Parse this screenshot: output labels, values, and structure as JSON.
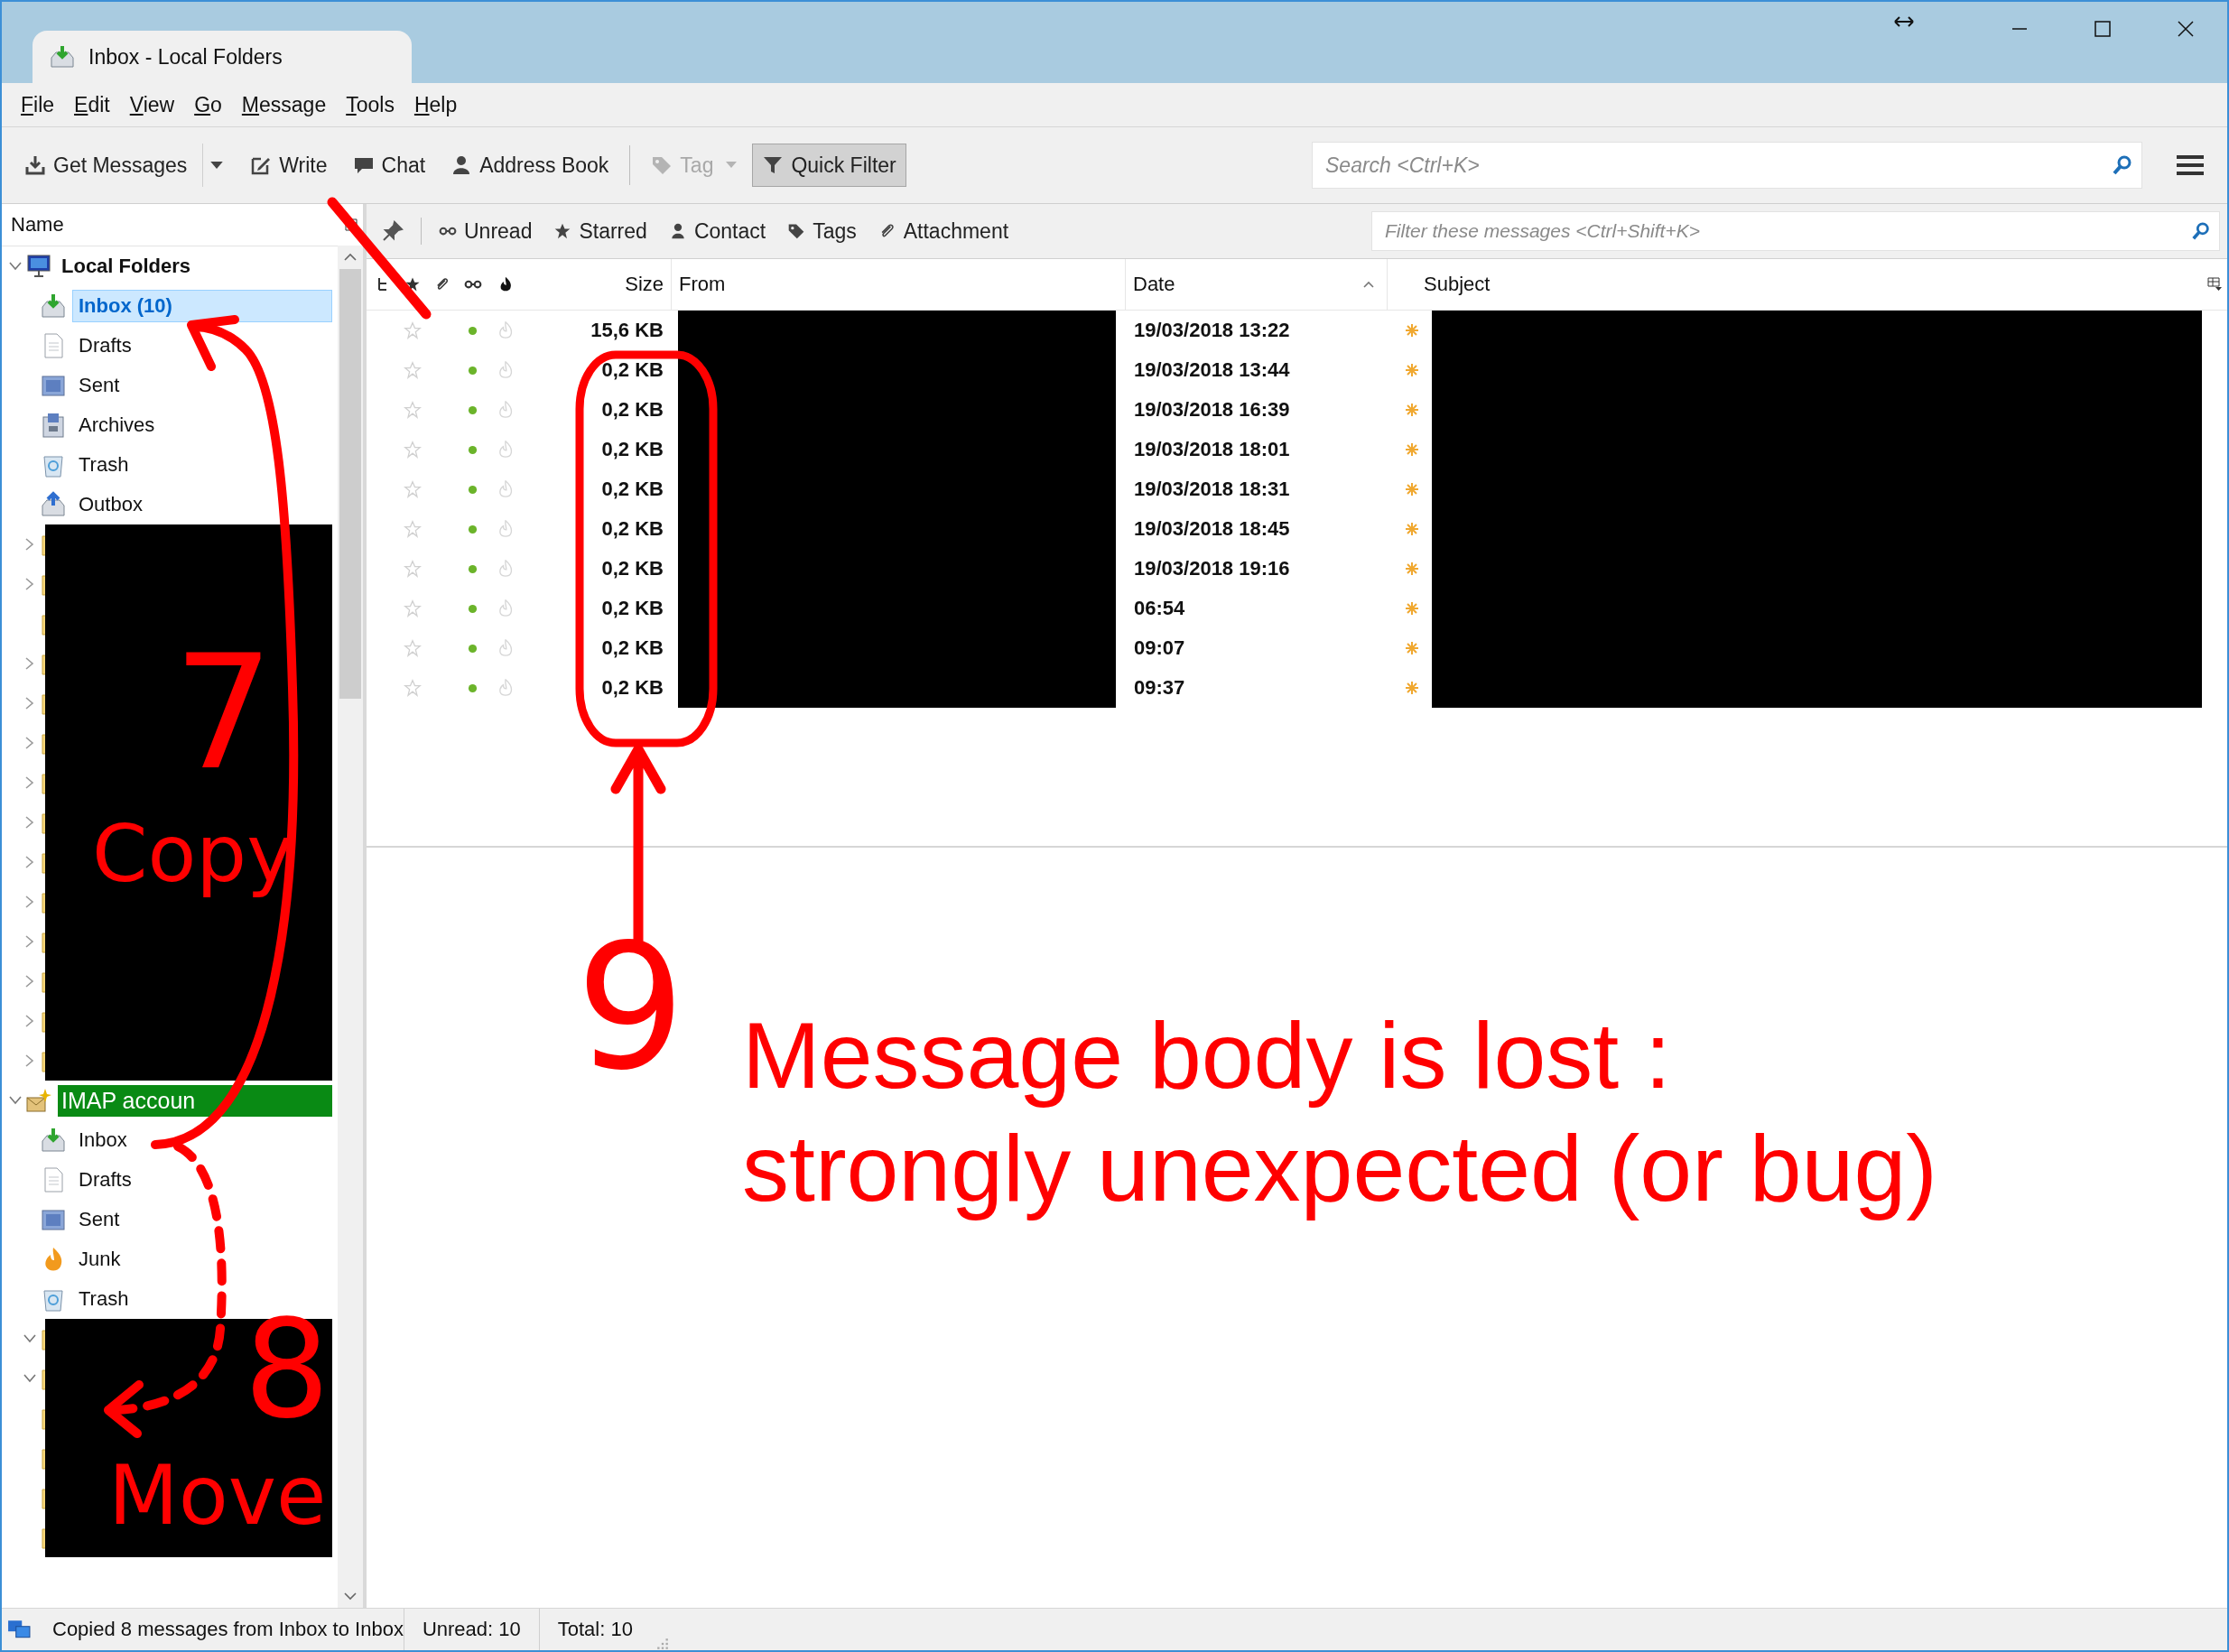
{
  "window": {
    "title": "Inbox - Local Folders"
  },
  "menu": [
    "File",
    "Edit",
    "View",
    "Go",
    "Message",
    "Tools",
    "Help"
  ],
  "toolbar": {
    "buttons": [
      {
        "label": "Get Messages",
        "kind": "split",
        "disabled": false,
        "selected": false
      },
      {
        "label": "Write",
        "kind": "plain",
        "disabled": false,
        "selected": false
      },
      {
        "label": "Chat",
        "kind": "plain",
        "disabled": false,
        "selected": false
      },
      {
        "label": "Address Book",
        "kind": "plain",
        "disabled": false,
        "selected": false
      },
      {
        "label": "Tag",
        "kind": "menu",
        "disabled": true,
        "selected": false
      },
      {
        "label": "Quick Filter",
        "kind": "plain",
        "disabled": false,
        "selected": true
      }
    ],
    "search": {
      "placeholder": "Search <Ctrl+K>"
    }
  },
  "quick_filter": {
    "toggles": [
      {
        "label": "Unread",
        "selected": false
      },
      {
        "label": "Starred",
        "selected": false
      },
      {
        "label": "Contact",
        "selected": false
      },
      {
        "label": "Tags",
        "selected": false
      },
      {
        "label": "Attachment",
        "selected": false
      }
    ],
    "placeholder": "Filter these messages <Ctrl+Shift+K>"
  },
  "folder_pane": {
    "header": "Name",
    "accounts": [
      {
        "name": "Local Folders",
        "kind": "local",
        "expanded": true,
        "selected": false,
        "highlighted": false,
        "children": [
          {
            "name": "Inbox (10)",
            "kind": "inbox",
            "selected": true
          },
          {
            "name": "Drafts",
            "kind": "drafts",
            "selected": false
          },
          {
            "name": "Sent",
            "kind": "sent",
            "selected": false
          },
          {
            "name": "Archives",
            "kind": "archives",
            "selected": false
          },
          {
            "name": "Trash",
            "kind": "trash",
            "selected": false
          },
          {
            "name": "Outbox",
            "kind": "outbox",
            "selected": false
          },
          {
            "kind": "redacted",
            "expanded": false
          },
          {
            "kind": "redacted",
            "expanded": false
          },
          {
            "kind": "redacted"
          },
          {
            "kind": "redacted",
            "expanded": false
          },
          {
            "kind": "redacted",
            "expanded": false
          },
          {
            "kind": "redacted",
            "expanded": false
          },
          {
            "kind": "redacted",
            "expanded": false
          },
          {
            "kind": "redacted",
            "expanded": false
          },
          {
            "kind": "redacted",
            "expanded": false
          },
          {
            "kind": "redacted",
            "expanded": false
          },
          {
            "kind": "redacted",
            "expanded": false
          },
          {
            "kind": "redacted",
            "expanded": false
          },
          {
            "kind": "redacted",
            "expanded": false
          },
          {
            "kind": "redacted",
            "expanded": false
          }
        ]
      },
      {
        "name": "IMAP accoun",
        "kind": "imap",
        "expanded": true,
        "selected": false,
        "highlighted": true,
        "children": [
          {
            "name": "Inbox",
            "kind": "inbox",
            "selected": false
          },
          {
            "name": "Drafts",
            "kind": "drafts",
            "selected": false
          },
          {
            "name": "Sent",
            "kind": "sent",
            "selected": false
          },
          {
            "name": "Junk",
            "kind": "junk",
            "selected": false
          },
          {
            "name": "Trash",
            "kind": "trash",
            "selected": false
          },
          {
            "kind": "redacted",
            "expanded": true
          },
          {
            "kind": "redacted",
            "expanded": true
          },
          {
            "kind": "redacted"
          },
          {
            "kind": "redacted"
          },
          {
            "kind": "redacted"
          },
          {
            "kind": "redacted"
          }
        ]
      }
    ]
  },
  "message_list": {
    "columns": [
      {
        "label": "Size"
      },
      {
        "label": "From"
      },
      {
        "label": "Date",
        "sorted": true
      },
      {
        "label": "Subject"
      }
    ],
    "rows": [
      {
        "starred": false,
        "unread": true,
        "new": true,
        "size": "15,6 KB",
        "date": "19/03/2018 13:22"
      },
      {
        "starred": false,
        "unread": true,
        "new": true,
        "size": "0,2 KB",
        "date": "19/03/2018 13:44"
      },
      {
        "starred": false,
        "unread": true,
        "new": true,
        "size": "0,2 KB",
        "date": "19/03/2018 16:39"
      },
      {
        "starred": false,
        "unread": true,
        "new": true,
        "size": "0,2 KB",
        "date": "19/03/2018 18:01"
      },
      {
        "starred": false,
        "unread": true,
        "new": true,
        "size": "0,2 KB",
        "date": "19/03/2018 18:31"
      },
      {
        "starred": false,
        "unread": true,
        "new": true,
        "size": "0,2 KB",
        "date": "19/03/2018 18:45"
      },
      {
        "starred": false,
        "unread": true,
        "new": true,
        "size": "0,2 KB",
        "date": "19/03/2018 19:16"
      },
      {
        "starred": false,
        "unread": true,
        "new": true,
        "size": "0,2 KB",
        "date": "06:54"
      },
      {
        "starred": false,
        "unread": true,
        "new": true,
        "size": "0,2 KB",
        "date": "09:07"
      },
      {
        "starred": false,
        "unread": true,
        "new": true,
        "size": "0,2 KB",
        "date": "09:37"
      }
    ]
  },
  "annotations": {
    "marks": [
      "7",
      "Copy",
      "8",
      "Move",
      "9"
    ],
    "caption": [
      "Message body is lost :",
      "strongly unexpected (or bug)"
    ]
  },
  "status_bar": {
    "message": "Copied 8 messages from Inbox to Inbox",
    "unread": "Unread: 10",
    "total": "Total: 10"
  }
}
